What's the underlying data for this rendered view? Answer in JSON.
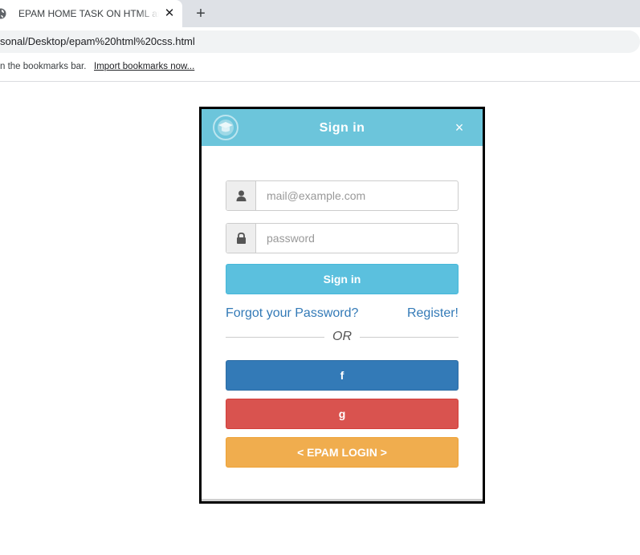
{
  "browser": {
    "tab_title": "EPAM HOME TASK ON HTML and CSS",
    "tab_close": "✕",
    "new_tab": "+",
    "url": "sonal/Desktop/epam%20html%20css.html",
    "bookmarks_text": "n the bookmarks bar.",
    "bookmarks_link": "Import bookmarks now..."
  },
  "modal": {
    "title": "Sign in",
    "close": "×",
    "email_placeholder": "mail@example.com",
    "password_placeholder": "password",
    "signin_button": "Sign in",
    "forgot_link": "Forgot your Password?",
    "register_link": "Register!",
    "or_label": "OR",
    "facebook_button": "f",
    "google_button": "g",
    "epam_button": "< EPAM LOGIN >"
  },
  "colors": {
    "header": "#6cc5db",
    "signin": "#5bc0de",
    "facebook": "#337ab7",
    "google": "#d9534f",
    "epam": "#f0ad4e",
    "link": "#337ab7"
  },
  "icons": {
    "favicon": "globe-icon",
    "logo": "graduation-cap-icon",
    "email_addon": "user-icon",
    "password_addon": "lock-icon"
  }
}
